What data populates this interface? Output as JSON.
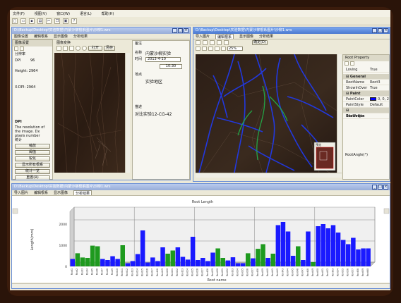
{
  "menubar": [
    "文件(F)",
    "视图(V)",
    "窗口(W)",
    "语言(L)",
    "帮助(H)"
  ],
  "toolbar_icons": [
    "new-icon",
    "open-icon",
    "save-icon",
    "print-icon",
    "cut-icon",
    "copy-icon",
    "paste-icon",
    "help-icon"
  ],
  "window1": {
    "title": "D:\\Backup\\Desktop\\实验数据\\内蒙沙柳根系图片\\沙柳1.wrs",
    "tabs": [
      "图像设置",
      "编辑根系",
      "显示图像",
      "分析结果"
    ],
    "image_settings": {
      "header": "图像设置",
      "rows": [
        {
          "label": "分辨率",
          "value": ""
        },
        {
          "label": "DPI",
          "value": "96"
        },
        {
          "label": "Height: 2964",
          "value": ""
        },
        {
          "label": "X-DPI: 2964",
          "value": ""
        }
      ],
      "info_label": "DPI",
      "info_text": "The resolution of the image. Dx pixels number",
      "section_label": "统计",
      "buttons": [
        [
          "缩放",
          "颜色"
        ],
        [
          "阈值",
          "灰度"
        ],
        [
          "锐化",
          "色调"
        ]
      ],
      "wide_buttons": [
        "显示所有根系",
        "统计一览",
        "重置(R)"
      ]
    },
    "image_tabs": [
      "图像变换",
      "打开",
      "另存"
    ],
    "notes": {
      "tab": "备注",
      "name_label": "名称",
      "name_value": "内蒙沙柳实验",
      "time_label": "时间",
      "date_value": "2013-4-10",
      "time_value": "10:30",
      "location_label": "地点",
      "location_value": "实验地区",
      "desc_label": "描述",
      "desc_value": "对比实验12-CG-42"
    }
  },
  "window2": {
    "title": "D:\\Backup\\Desktop\\实验数据\\内蒙沙柳根系图片\\沙柳1.wrs",
    "tabs": [
      "导入图片",
      "编辑根系",
      "显示图像",
      "分析结果"
    ],
    "toolbar_label": "确定(D)",
    "zoom_value": "25%",
    "preview_label": "预览",
    "property": {
      "header": "Root Property",
      "rows": [
        {
          "type": "row",
          "key": "Loving",
          "value": "True"
        },
        {
          "type": "cat",
          "key": "General",
          "value": ""
        },
        {
          "type": "row",
          "key": "RootName",
          "value": "Root3"
        },
        {
          "type": "row",
          "key": "ShowInOver",
          "value": "True"
        },
        {
          "type": "cat",
          "key": "Paint",
          "value": ""
        },
        {
          "type": "swatch",
          "key": "PaintColor",
          "value": "0, 0, 255"
        },
        {
          "type": "row",
          "key": "PaintStyle",
          "value": "Default"
        },
        {
          "type": "cat",
          "key": "Statistics",
          "value": ""
        },
        {
          "type": "row",
          "key": "RootAngle",
          "value": ""
        }
      ],
      "footer": "RootAngle(°)"
    }
  },
  "window3": {
    "title": "D:\\Backup\\Desktop\\实验数据\\内蒙沙柳根系图片\\沙柳1.wrs",
    "tabs": [
      "导入图片",
      "编辑根系",
      "显示图像",
      "分析结果"
    ]
  },
  "chart_data": {
    "type": "bar",
    "title": "Root Length",
    "xlabel": "Root name",
    "ylabel": "Length(mm)",
    "ylim": [
      0,
      2600
    ],
    "yticks": [
      0,
      1000,
      2000
    ],
    "categories": [
      "Root1",
      "Root2",
      "Root3",
      "Root4",
      "Root5",
      "Root6",
      "Root7",
      "Root8",
      "Root9",
      "Root10",
      "Root11",
      "Root12",
      "Root13",
      "Root14",
      "Root15",
      "Root16",
      "Root17",
      "Root18",
      "Root19",
      "Root20",
      "Root21",
      "Root22",
      "Root23",
      "Root24",
      "Root25",
      "Root26",
      "Root27",
      "Root28",
      "Root29",
      "Root30",
      "Root31",
      "Root32",
      "Root33",
      "Root34",
      "Root35",
      "Root36",
      "Root37",
      "Root38",
      "Root39",
      "Root40",
      "Root41",
      "Root42",
      "Root43",
      "Root44",
      "Root45",
      "Root46",
      "Root47",
      "Root48",
      "Root49",
      "Root50",
      "Root51",
      "Root52",
      "Root53",
      "Root54",
      "Root55",
      "Root56",
      "Root57",
      "Root58",
      "Root59",
      "Root60"
    ],
    "values": [
      350,
      620,
      420,
      400,
      980,
      950,
      350,
      300,
      480,
      350,
      1000,
      150,
      250,
      580,
      1700,
      180,
      420,
      250,
      900,
      600,
      750,
      900,
      450,
      320,
      1400,
      300,
      400,
      250,
      650,
      850,
      400,
      280,
      430,
      150,
      150,
      620,
      380,
      830,
      1050,
      400,
      600,
      1950,
      2100,
      1650,
      500,
      950,
      300,
      1650,
      200,
      1900,
      2000,
      1800,
      1950,
      1600,
      1250,
      1050,
      1350,
      800,
      850,
      850
    ],
    "colors": [
      "blue",
      "green",
      "green",
      "green",
      "green",
      "green",
      "blue",
      "blue",
      "blue",
      "blue",
      "green",
      "blue",
      "blue",
      "blue",
      "blue",
      "blue",
      "blue",
      "blue",
      "blue",
      "green",
      "green",
      "blue",
      "blue",
      "blue",
      "blue",
      "blue",
      "blue",
      "blue",
      "blue",
      "green",
      "green",
      "blue",
      "blue",
      "blue",
      "blue",
      "green",
      "blue",
      "green",
      "green",
      "blue",
      "green",
      "blue",
      "blue",
      "blue",
      "blue",
      "green",
      "blue",
      "blue",
      "green",
      "blue",
      "blue",
      "blue",
      "blue",
      "blue",
      "blue",
      "blue",
      "blue",
      "blue",
      "blue",
      "blue"
    ],
    "palette": {
      "blue": "#1a1aff",
      "green": "#1e9a1e"
    },
    "grid": true,
    "legend": "none"
  }
}
